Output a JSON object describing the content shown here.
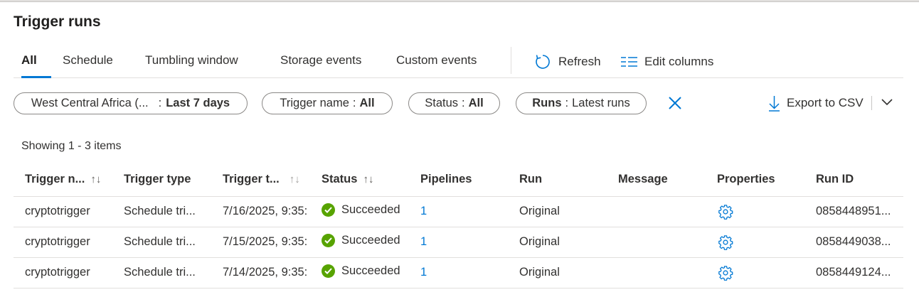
{
  "page": {
    "title": "Trigger runs"
  },
  "tabs": [
    {
      "label": "All",
      "active": true
    },
    {
      "label": "Schedule",
      "active": false
    },
    {
      "label": "Tumbling window",
      "active": false
    },
    {
      "label": "Storage events",
      "active": false
    },
    {
      "label": "Custom events",
      "active": false
    }
  ],
  "commands": {
    "refresh": "Refresh",
    "edit_columns": "Edit columns"
  },
  "filters": {
    "region": {
      "label": "West Central Africa (...",
      "sep": ":",
      "value": "Last 7 days"
    },
    "trigger_name": {
      "label": "Trigger name",
      "sep": ":",
      "value": "All"
    },
    "status": {
      "label": "Status",
      "sep": ":",
      "value": "All"
    },
    "runs": {
      "label": "Runs",
      "sep": ":",
      "value": "Latest runs"
    }
  },
  "export": {
    "label": "Export to CSV"
  },
  "showing": "Showing 1 - 3 items",
  "columns": [
    "Trigger n...",
    "Trigger type",
    "Trigger t...",
    "Status",
    "Pipelines",
    "Run",
    "Message",
    "Properties",
    "Run ID"
  ],
  "sort_icon": "↑↓",
  "rows": [
    {
      "name": "cryptotrigger",
      "type": "Schedule tri...",
      "time": "7/16/2025, 9:35:",
      "status": "Succeeded",
      "pipelines": "1",
      "run": "Original",
      "message": "",
      "run_id": "0858448951..."
    },
    {
      "name": "cryptotrigger",
      "type": "Schedule tri...",
      "time": "7/15/2025, 9:35:",
      "status": "Succeeded",
      "pipelines": "1",
      "run": "Original",
      "message": "",
      "run_id": "0858449038..."
    },
    {
      "name": "cryptotrigger",
      "type": "Schedule tri...",
      "time": "7/14/2025, 9:35:",
      "status": "Succeeded",
      "pipelines": "1",
      "run": "Original",
      "message": "",
      "run_id": "0858449124..."
    }
  ],
  "colors": {
    "accent": "#0078d4",
    "success": "#57a300",
    "border": "#e1dfdd"
  },
  "icons": {
    "refresh": "refresh-icon",
    "edit_columns": "edit-columns-icon",
    "clear": "close-icon",
    "export": "download-icon",
    "chevron": "chevron-down-icon",
    "status_ok": "checkmark-circle-icon",
    "properties": "gear-icon"
  }
}
